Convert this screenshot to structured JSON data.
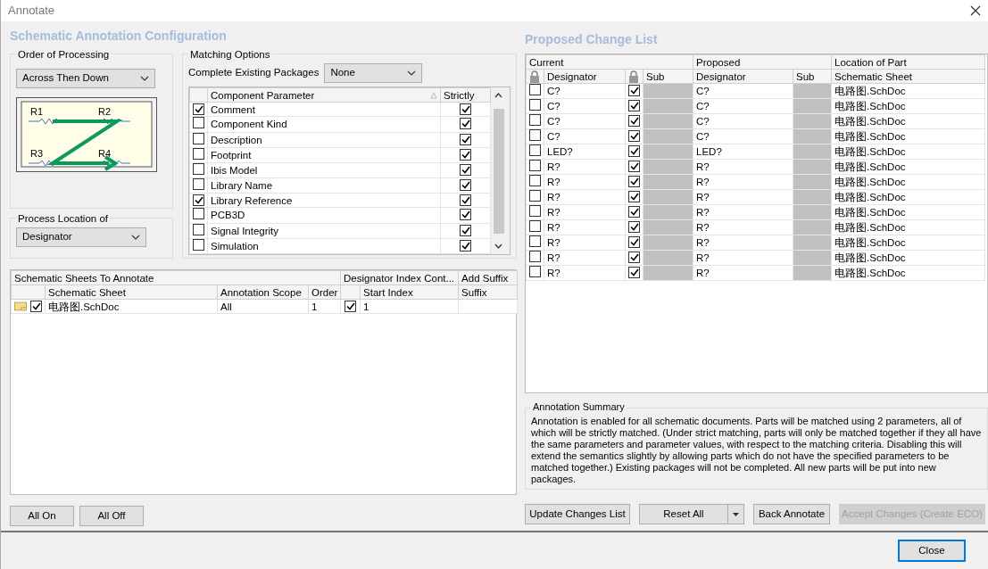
{
  "window": {
    "title": "Annotate"
  },
  "config_title": "Schematic Annotation Configuration",
  "order_of_processing": {
    "label": "Order of Processing",
    "value": "Across Then Down",
    "diagram_labels": [
      "R1",
      "R2",
      "R3",
      "R4"
    ]
  },
  "process_location": {
    "label": "Process Location of",
    "value": "Designator"
  },
  "matching_options": {
    "label": "Matching Options",
    "packages_label": "Complete Existing Packages",
    "packages_value": "None",
    "columns": [
      "Component Parameter",
      "Strictly"
    ],
    "rows": [
      {
        "name": "Comment",
        "checked": true,
        "strictly": true
      },
      {
        "name": "Component Kind",
        "checked": false,
        "strictly": true
      },
      {
        "name": "Description",
        "checked": false,
        "strictly": true
      },
      {
        "name": "Footprint",
        "checked": false,
        "strictly": true
      },
      {
        "name": "Ibis Model",
        "checked": false,
        "strictly": true
      },
      {
        "name": "Library Name",
        "checked": false,
        "strictly": true
      },
      {
        "name": "Library Reference",
        "checked": true,
        "strictly": true
      },
      {
        "name": "PCB3D",
        "checked": false,
        "strictly": true
      },
      {
        "name": "Signal Integrity",
        "checked": false,
        "strictly": true
      },
      {
        "name": "Simulation",
        "checked": false,
        "strictly": true
      }
    ]
  },
  "sheets_table": {
    "group_headers": [
      "Schematic Sheets To Annotate",
      "Designator Index Cont...",
      "Add Suffix"
    ],
    "columns": [
      "Schematic Sheet",
      "Annotation Scope",
      "Order",
      "Start Index",
      "Suffix"
    ],
    "rows": [
      {
        "checked": true,
        "sheet": "电路图.SchDoc",
        "scope": "All",
        "order": "1",
        "index_checked": true,
        "start_index": "1"
      }
    ]
  },
  "sheet_buttons": [
    "All On",
    "All Off"
  ],
  "change_list": {
    "title": "Proposed Change List",
    "group_headers": [
      "Current",
      "Proposed",
      "Location of Part"
    ],
    "columns": [
      "Designator",
      "Sub",
      "Designator",
      "Sub",
      "Schematic Sheet"
    ],
    "rows": [
      {
        "locked": false,
        "current": "C?",
        "sub_checked": true,
        "proposed": "C?",
        "sheet": "电路图.SchDoc"
      },
      {
        "locked": false,
        "current": "C?",
        "sub_checked": true,
        "proposed": "C?",
        "sheet": "电路图.SchDoc"
      },
      {
        "locked": false,
        "current": "C?",
        "sub_checked": true,
        "proposed": "C?",
        "sheet": "电路图.SchDoc"
      },
      {
        "locked": false,
        "current": "C?",
        "sub_checked": true,
        "proposed": "C?",
        "sheet": "电路图.SchDoc"
      },
      {
        "locked": false,
        "current": "LED?",
        "sub_checked": true,
        "proposed": "LED?",
        "sheet": "电路图.SchDoc"
      },
      {
        "locked": false,
        "current": "R?",
        "sub_checked": true,
        "proposed": "R?",
        "sheet": "电路图.SchDoc"
      },
      {
        "locked": false,
        "current": "R?",
        "sub_checked": true,
        "proposed": "R?",
        "sheet": "电路图.SchDoc"
      },
      {
        "locked": false,
        "current": "R?",
        "sub_checked": true,
        "proposed": "R?",
        "sheet": "电路图.SchDoc"
      },
      {
        "locked": false,
        "current": "R?",
        "sub_checked": true,
        "proposed": "R?",
        "sheet": "电路图.SchDoc"
      },
      {
        "locked": false,
        "current": "R?",
        "sub_checked": true,
        "proposed": "R?",
        "sheet": "电路图.SchDoc"
      },
      {
        "locked": false,
        "current": "R?",
        "sub_checked": true,
        "proposed": "R?",
        "sheet": "电路图.SchDoc"
      },
      {
        "locked": false,
        "current": "R?",
        "sub_checked": true,
        "proposed": "R?",
        "sheet": "电路图.SchDoc"
      },
      {
        "locked": false,
        "current": "R?",
        "sub_checked": true,
        "proposed": "R?",
        "sheet": "电路图.SchDoc"
      }
    ]
  },
  "summary": {
    "title": "Annotation Summary",
    "text": "Annotation is enabled for all schematic documents. Parts will be matched using 2 parameters, all of which will be strictly matched. (Under strict matching, parts will only be matched together if they all have the same parameters and parameter values, with respect to the matching criteria. Disabling this will extend the semantics slightly by allowing parts which do not have the specified parameters to be matched together.) Existing packages will not be completed. All new parts will be put into new packages."
  },
  "action_buttons": [
    {
      "label": "Update Changes List",
      "kind": "button",
      "disabled": false
    },
    {
      "label": "Reset All",
      "kind": "split",
      "disabled": false
    },
    {
      "label": "Back Annotate",
      "kind": "button",
      "disabled": false
    },
    {
      "label": "Accept Changes (Create ECO)",
      "kind": "button",
      "disabled": true
    }
  ],
  "close_button": "Close"
}
